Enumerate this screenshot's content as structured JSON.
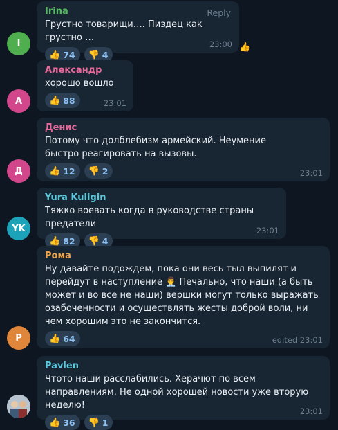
{
  "messages": [
    {
      "sender": "Irina",
      "sender_color": "#56b960",
      "avatar_letter": "I",
      "avatar_color": "#4fae4e",
      "text": "Грустно товарищи…. Пиздец как грустно …",
      "reply_label": "Reply",
      "likes": "74",
      "dislikes": "4",
      "time": "23:00",
      "side_reaction": "👍"
    },
    {
      "sender": "Александр",
      "sender_color": "#e56a9a",
      "avatar_letter": "А",
      "avatar_color": "#d2478b",
      "text": "хорошо вошло",
      "likes": "88",
      "time": "23:01"
    },
    {
      "sender": "Денис",
      "sender_color": "#e56a9a",
      "avatar_letter": "Д",
      "avatar_color": "#d2478b",
      "text": "Потому что долблебизм армейский. Неумение быстро реагировать на вызовы.",
      "likes": "12",
      "dislikes": "2",
      "time": "23:01"
    },
    {
      "sender": "Yura Kuligin",
      "sender_color": "#5ac9dc",
      "avatar_letter": "YK",
      "avatar_color": "#1da3b9",
      "text": "Тяжко воевать когда в руководстве страны предатели",
      "likes": "82",
      "dislikes": "4",
      "time": "23:01"
    },
    {
      "sender": "Рома",
      "sender_color": "#e9a451",
      "avatar_letter": "Р",
      "avatar_color": "#e0863a",
      "text": "Ну давайте подождем, пока они весь тыл выпилят и перейдут в наступление 👨‍💼 Печально, что наши (а быть может и во все не наши) вершки могут только выражать озабоченности и осуществлять жесты доброй воли, ни чем хорошим это не закончится.",
      "likes": "64",
      "time": "edited 23:01"
    },
    {
      "sender": "Pavlen",
      "sender_color": "#5ac9dc",
      "text": "Чтото наши расслабились. Херачют по всем направлениям. Не одной хорошей новости уже вторую неделю!",
      "likes": "36",
      "dislikes": "1",
      "time": "23:01"
    }
  ],
  "icons": {
    "like": "👍",
    "dislike": "👎"
  }
}
